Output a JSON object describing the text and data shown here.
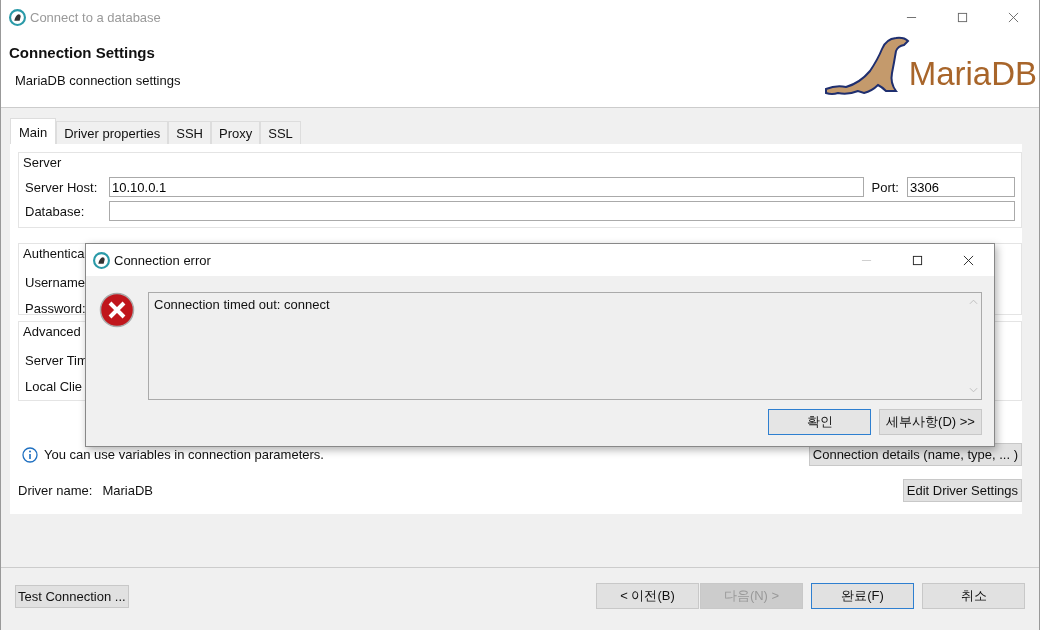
{
  "window": {
    "title": "Connect to a database",
    "heading": "Connection Settings",
    "subtitle": "MariaDB connection settings",
    "logo_text": "MariaDB"
  },
  "tabs": [
    {
      "label": "Main",
      "selected": true
    },
    {
      "label": "Driver properties",
      "selected": false
    },
    {
      "label": "SSH",
      "selected": false
    },
    {
      "label": "Proxy",
      "selected": false
    },
    {
      "label": "SSL",
      "selected": false
    }
  ],
  "server": {
    "title": "Server",
    "host_label": "Server Host:",
    "host_value": "10.10.0.1",
    "port_label": "Port:",
    "port_value": "3306",
    "database_label": "Database:"
  },
  "authentication": {
    "title": "Authentica",
    "labels": [
      "Username",
      "Password:"
    ]
  },
  "advanced": {
    "title": "Advanced",
    "labels": [
      "Server Tim",
      "Local Clie"
    ]
  },
  "info": "You can use variables in connection parameters.",
  "connection_details_button": "Connection details (name, type, ... )",
  "driver": {
    "label": "Driver name:",
    "value": "MariaDB"
  },
  "edit_driver_button": "Edit Driver Settings",
  "test_button": "Test Connection ...",
  "nav_buttons": [
    {
      "label": "< 이전(B)",
      "disabled": false,
      "default": false
    },
    {
      "label": "다음(N) >",
      "disabled": true,
      "default": false
    },
    {
      "label": "완료(F)",
      "disabled": false,
      "default": true
    },
    {
      "label": "취소",
      "disabled": false,
      "default": false
    }
  ],
  "dialog": {
    "title": "Connection error",
    "message": "Connection timed out: connect",
    "buttons": [
      {
        "label": "확인",
        "default": true
      },
      {
        "label": "세부사항(D) >>",
        "default": false
      }
    ]
  }
}
